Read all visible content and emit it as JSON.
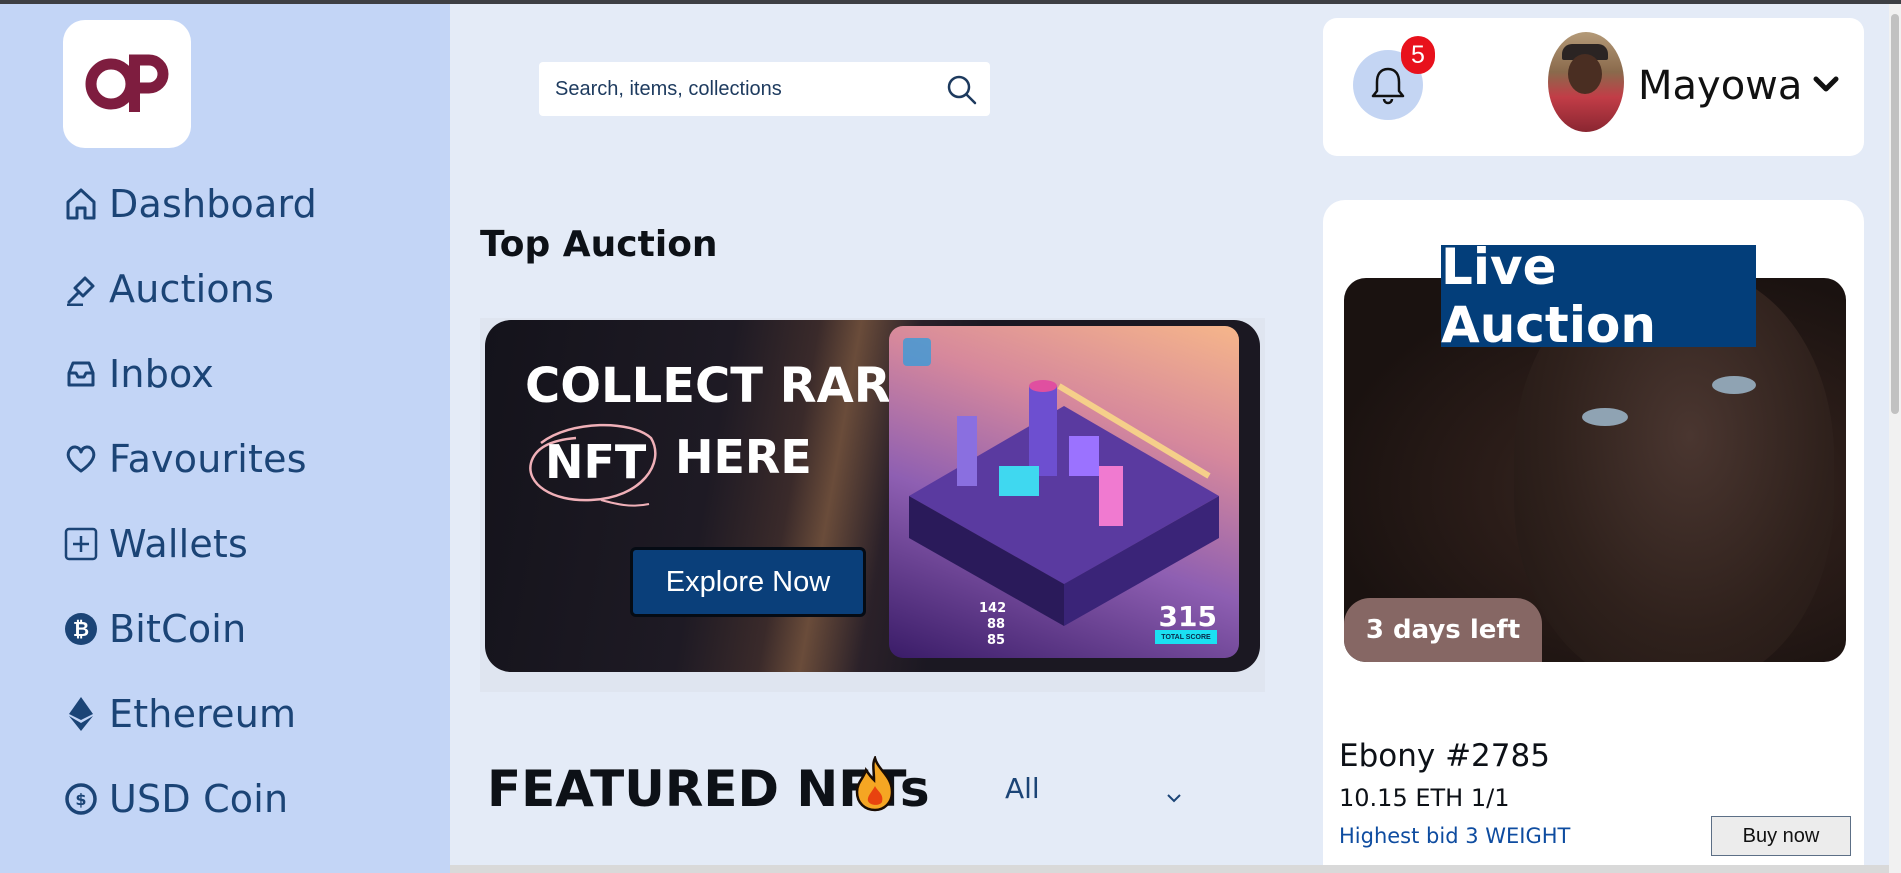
{
  "colors": {
    "sidebar_bg": "#c3d5f6",
    "page_bg": "#e4ebf7",
    "primary": "#033e7a",
    "nav_text": "#1b4476",
    "badge": "#e8111c",
    "days_left_bg": "#866764"
  },
  "logo": {
    "icon": "op-logo"
  },
  "sidebar": {
    "items": [
      {
        "label": "Dashboard",
        "icon": "home-icon"
      },
      {
        "label": "Auctions",
        "icon": "gavel-icon"
      },
      {
        "label": "Inbox",
        "icon": "inbox-icon"
      },
      {
        "label": "Favourites",
        "icon": "heart-icon"
      },
      {
        "label": "Wallets",
        "icon": "plus-square-icon"
      },
      {
        "label": "BitCoin",
        "icon": "bitcoin-icon"
      },
      {
        "label": "Ethereum",
        "icon": "ethereum-icon"
      },
      {
        "label": "USD Coin",
        "icon": "usd-coin-icon"
      }
    ]
  },
  "search": {
    "placeholder": "Search, items, collections",
    "value": ""
  },
  "header": {
    "notifications_count": "5",
    "username": "Mayowa"
  },
  "top_auction": {
    "title": "Top Auction",
    "banner": {
      "headline": "COLLECT RARE",
      "highlight": "NFT",
      "suffix": "HERE",
      "button_label": "Explore Now",
      "stats": [
        "142",
        "88",
        "85"
      ],
      "score": "315",
      "score_label": "TOTAL SCORE"
    }
  },
  "featured": {
    "title": "FEATURED NFTs",
    "filter_value": "All"
  },
  "live_auction": {
    "title": "Live Auction",
    "time_left": "3 days left",
    "nft_name": "Ebony #2785",
    "price": "10.15 ETH 1/1",
    "highest_bid": "Highest bid 3 WEIGHT",
    "buy_label": "Buy now"
  }
}
